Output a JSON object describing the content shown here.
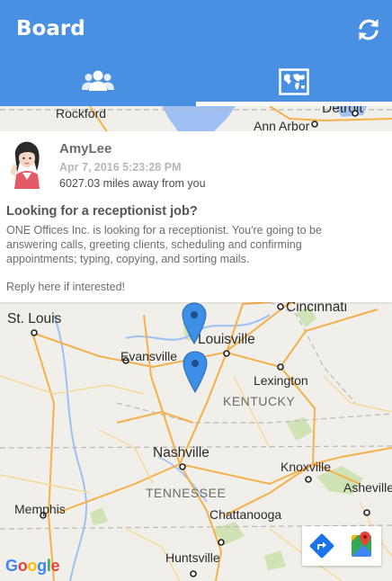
{
  "appbar": {
    "title": "Board",
    "color": "#4a90e2",
    "refresh_icon": "refresh-icon",
    "tabs": [
      {
        "name": "people",
        "icon": "people-icon",
        "selected": false
      },
      {
        "name": "map",
        "icon": "world-map-icon",
        "selected": true
      }
    ]
  },
  "post": {
    "user": "AmyLee",
    "date": "Apr 7, 2016 5:23:28 PM",
    "distance": "6027.03 miles away from you",
    "title": "Looking for a receptionist job?",
    "body": "ONE Offices Inc. is looking for a receptionist. You're going to be answering calls, greeting clients, scheduling and confirming appointments; typing, copying, and sorting mails.",
    "reply": "Reply here if interested!"
  },
  "map": {
    "cities": {
      "rockford": "Rockford",
      "detroit": "Detroit",
      "ann_arbor": "Ann Arbor",
      "st_louis": "St. Louis",
      "cincinnati": "Cincinnati",
      "louisville": "Louisville",
      "evansville": "Evansville",
      "lexington": "Lexington",
      "nashville": "Nashville",
      "knoxville": "Knoxville",
      "asheville": "Asheville",
      "memphis": "Memphis",
      "chattanooga": "Chattanooga",
      "huntsville": "Huntsville"
    },
    "states": {
      "kentucky": "KENTUCKY",
      "tennessee": "TENNESSEE"
    },
    "pin_color": "#3d8ee6",
    "pin_count": 2,
    "logo_text": "Google",
    "actions": [
      "directions-icon",
      "google-maps-icon"
    ]
  }
}
